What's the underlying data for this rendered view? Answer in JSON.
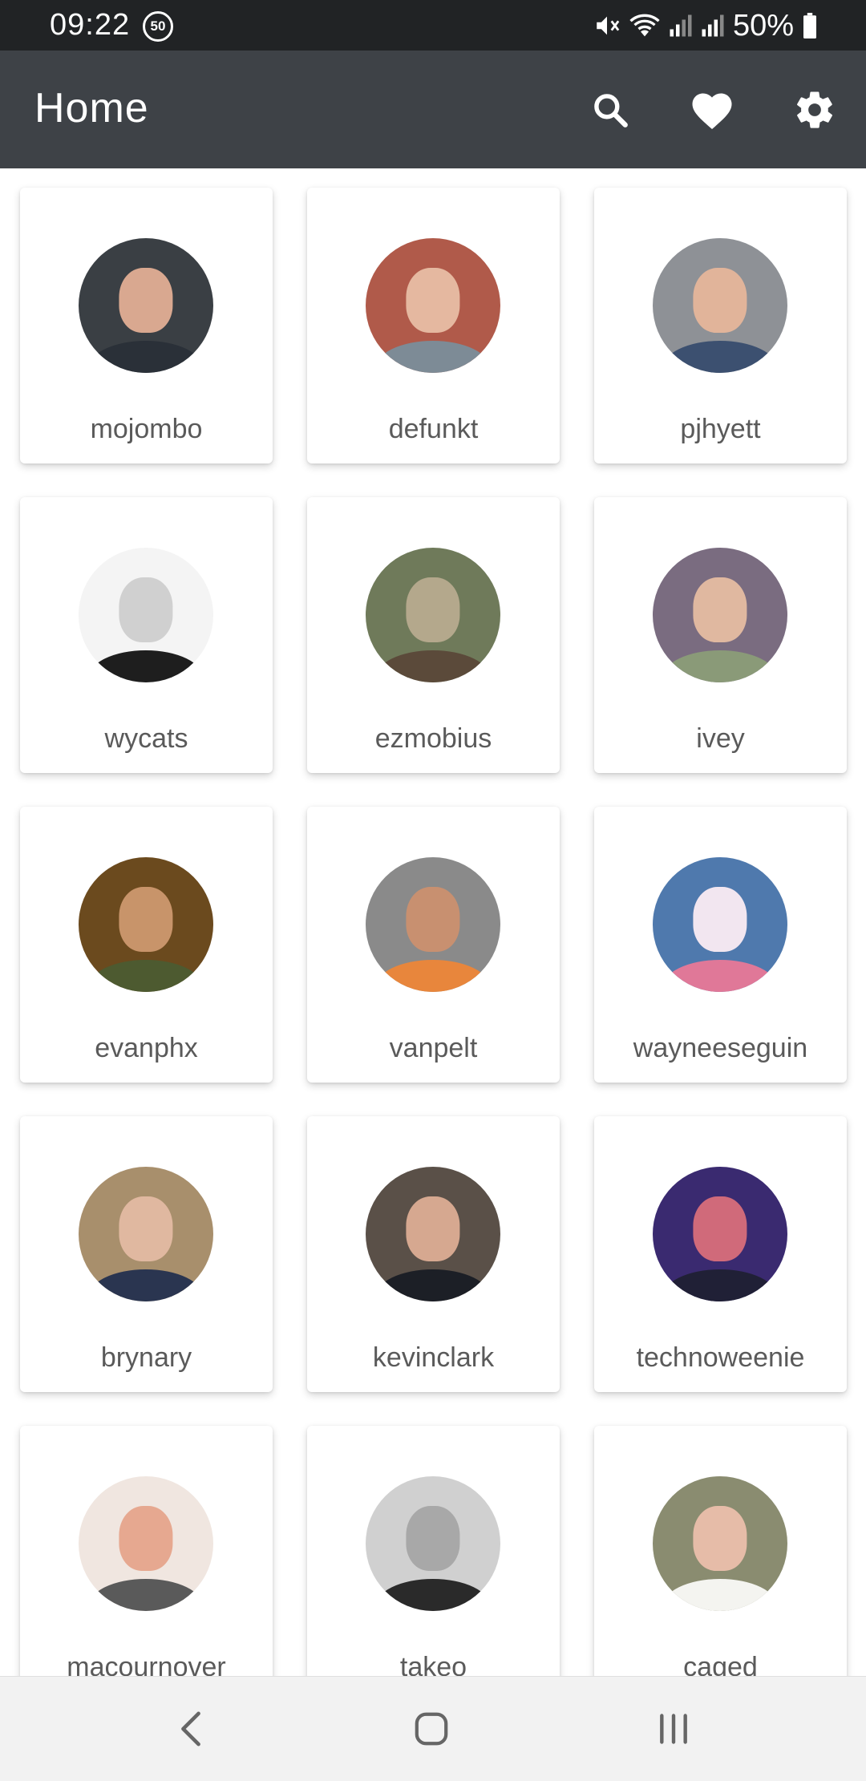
{
  "status_bar": {
    "time": "09:22",
    "badge": "50",
    "battery_pct": "50%",
    "icons": [
      "mute-icon",
      "wifi-icon",
      "signal-icon",
      "signal-icon",
      "battery-icon"
    ]
  },
  "app_bar": {
    "title": "Home",
    "actions": [
      "search-icon",
      "heart-icon",
      "gear-icon"
    ]
  },
  "users": [
    {
      "name": "mojombo",
      "avatar_bg": "#3a3f44",
      "skin": "#d9a890",
      "shirt": "#2a3038"
    },
    {
      "name": "defunkt",
      "avatar_bg": "#b05a4a",
      "skin": "#e5b8a0",
      "shirt": "#7d8b96"
    },
    {
      "name": "pjhyett",
      "avatar_bg": "#8e9196",
      "skin": "#e1b49a",
      "shirt": "#3c5070"
    },
    {
      "name": "wycats",
      "avatar_bg": "#f4f4f4",
      "skin": "#d0d0d0",
      "shirt": "#1e1e1e"
    },
    {
      "name": "ezmobius",
      "avatar_bg": "#6f7a5a",
      "skin": "#b4a88c",
      "shirt": "#5b4a3a"
    },
    {
      "name": "ivey",
      "avatar_bg": "#7a6c80",
      "skin": "#e0b8a0",
      "shirt": "#8a9a78"
    },
    {
      "name": "evanphx",
      "avatar_bg": "#6b4a1e",
      "skin": "#c8946a",
      "shirt": "#4d5a30"
    },
    {
      "name": "vanpelt",
      "avatar_bg": "#8a8a8a",
      "skin": "#c89070",
      "shirt": "#e8863c"
    },
    {
      "name": "wayneeseguin",
      "avatar_bg": "#4f79ad",
      "skin": "#f2e6f0",
      "shirt": "#e07898"
    },
    {
      "name": "brynary",
      "avatar_bg": "#a88f6c",
      "skin": "#e0b8a0",
      "shirt": "#2a3550"
    },
    {
      "name": "kevinclark",
      "avatar_bg": "#5a5048",
      "skin": "#d6a890",
      "shirt": "#1c1f26"
    },
    {
      "name": "technoweenie",
      "avatar_bg": "#3a2a70",
      "skin": "#d06a7a",
      "shirt": "#202036"
    },
    {
      "name": "macournover",
      "avatar_bg": "#f0e6e0",
      "skin": "#e6a890",
      "shirt": "#5a5a5a"
    },
    {
      "name": "takeo",
      "avatar_bg": "#d0d0d0",
      "skin": "#a8a8a8",
      "shirt": "#2a2a2a"
    },
    {
      "name": "caged",
      "avatar_bg": "#8a8c70",
      "skin": "#e6bca8",
      "shirt": "#f4f4f0"
    }
  ],
  "nav_bar": {
    "buttons": [
      "back-icon",
      "home-icon",
      "recent-apps-icon"
    ]
  }
}
